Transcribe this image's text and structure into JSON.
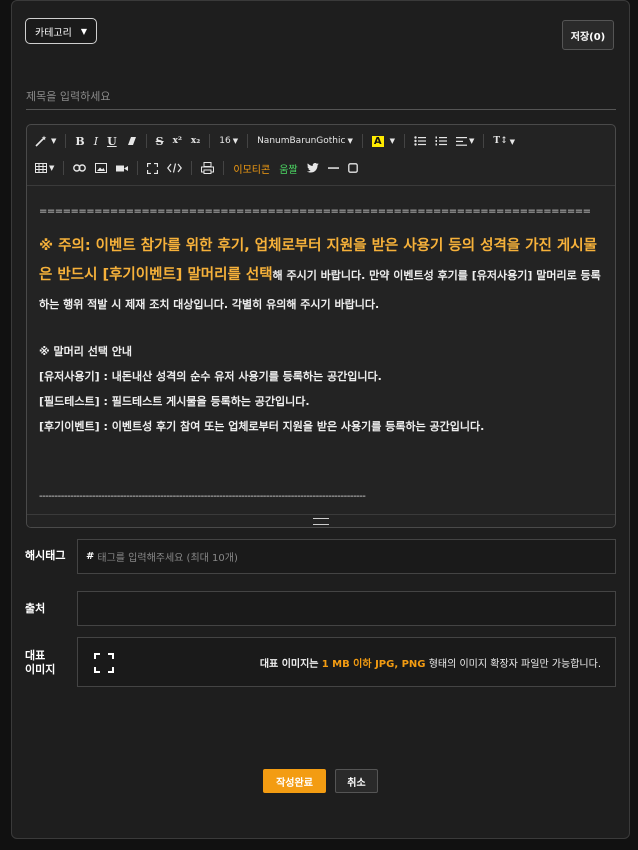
{
  "header": {
    "category_label": "카테고리",
    "save_label": "저장(0)"
  },
  "title_field": {
    "placeholder": "제목을 입력하세요",
    "value": ""
  },
  "toolbar": {
    "font_size": "16",
    "font_family": "NanumBarunGothic",
    "highlight_letter": "A",
    "emoticon_label": "이모티콘",
    "ogbol_label": "움짤",
    "bold": "B",
    "italic": "I",
    "underline": "U",
    "strike": "S",
    "superscript": "x²",
    "subscript": "x₂",
    "text_size": "T↕"
  },
  "editor": {
    "rule_line": "======================================================================",
    "notice_prefix": "※ 주의: ",
    "notice_underlined": "이벤트 참가를 위한 후기, 업체로부터 지원을 받은 사용기 등의 성격을 가진 게시물은 반드시 [후기이벤트] 말머리를 선택",
    "notice_rest": "해 주시기 바랍니다. 만약 이벤트성 후기를 [유저사용기] 말머리로 등록하는 행위 적발 시 제재 조치 대상입니다. 각별히 유의해 주시기 바랍니다.",
    "guide_title": "※ 말머리 선택 안내",
    "guide_items": [
      "[유저사용기] : 내돈내산 성격의 순수 유저 사용기를 등록하는 공간입니다.",
      "[필드테스트] : 필드테스트 게시물을 등록하는 공간입니다.",
      "[후기이벤트] : 이벤트성 후기 참여 또는 업체로부터 지원을 받은 사용기를 등록하는 공간입니다."
    ],
    "dash_line": "---------------------------------------------------------------------------------------------------------"
  },
  "hashtag": {
    "label": "해시태그",
    "hash_symbol": "#",
    "placeholder": "태그를 입력해주세요 (최대 10개)"
  },
  "source": {
    "label": "출처",
    "value": ""
  },
  "rep_image": {
    "label_line1": "대표",
    "label_line2": "이미지",
    "note_lead": "대표 이미지는",
    "note_highlight": "1 MB 이하 JPG, PNG",
    "note_tail": "형태의 이미지 확장자 파일만 가능합니다."
  },
  "actions": {
    "submit_label": "작성완료",
    "cancel_label": "취소"
  },
  "colors": {
    "accent": "#f39c12",
    "notice": "#f6b13a",
    "background": "#1e1e1e"
  }
}
